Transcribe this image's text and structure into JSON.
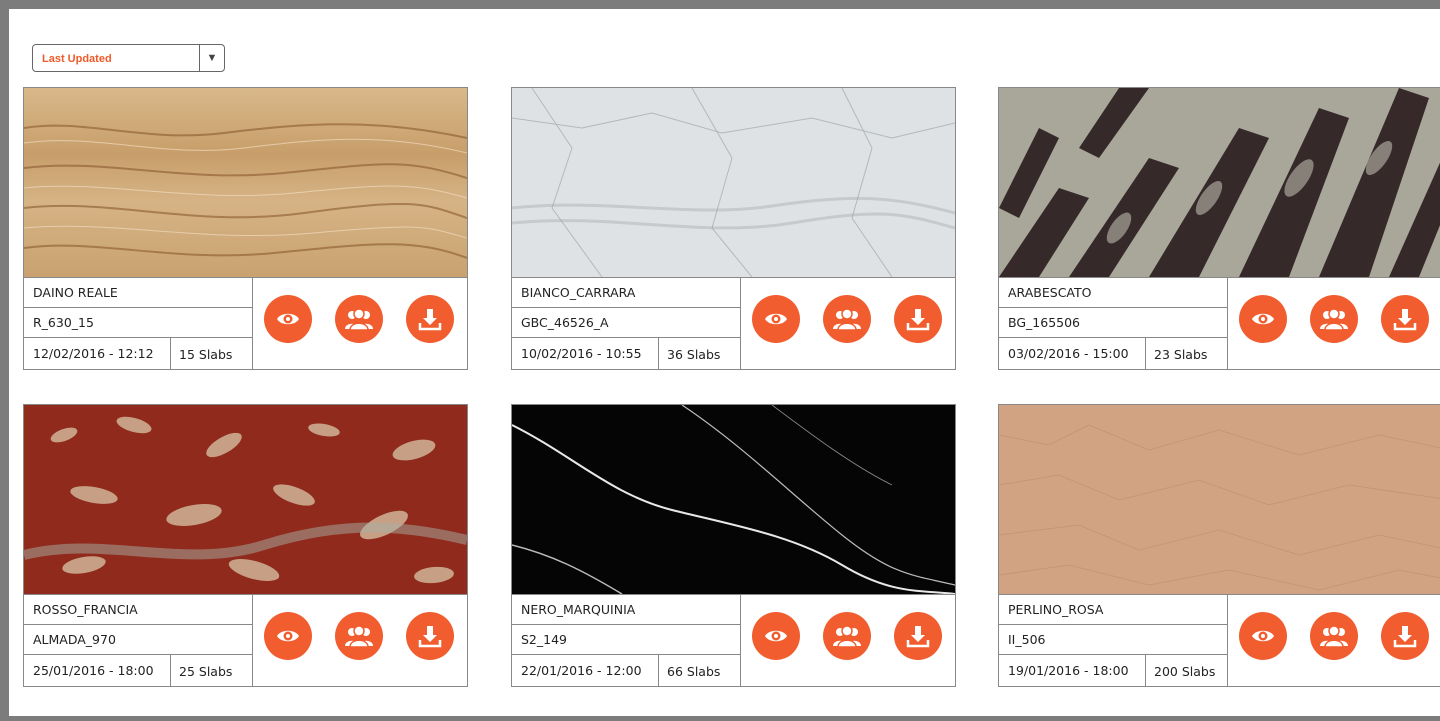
{
  "sort": {
    "label": "Last Updated"
  },
  "colors": {
    "accent": "#f15d2e",
    "frame": "#7c7c7c"
  },
  "cards": [
    {
      "name": "DAINO REALE",
      "code": "R_630_15",
      "date": "12/02/2016 - 12:12",
      "slabs": "15 Slabs",
      "texture": "daino"
    },
    {
      "name": "BIANCO_CARRARA",
      "code": "GBC_46526_A",
      "date": "10/02/2016 - 10:55",
      "slabs": "36 Slabs",
      "texture": "carrara"
    },
    {
      "name": "ARABESCATO",
      "code": "BG_165506",
      "date": "03/02/2016 - 15:00",
      "slabs": "23 Slabs",
      "texture": "arabescato"
    },
    {
      "name": "ROSSO_FRANCIA",
      "code": "ALMADA_970",
      "date": "25/01/2016 - 18:00",
      "slabs": "25 Slabs",
      "texture": "rosso"
    },
    {
      "name": "NERO_MARQUINIA",
      "code": "S2_149",
      "date": "22/01/2016 - 12:00",
      "slabs": "66 Slabs",
      "texture": "nero"
    },
    {
      "name": "PERLINO_ROSA",
      "code": "II_506",
      "date": "19/01/2016 - 18:00",
      "slabs": "200 Slabs",
      "texture": "perlino"
    }
  ],
  "icons": {
    "view": "eye-icon",
    "share": "users-icon",
    "download": "download-icon"
  }
}
